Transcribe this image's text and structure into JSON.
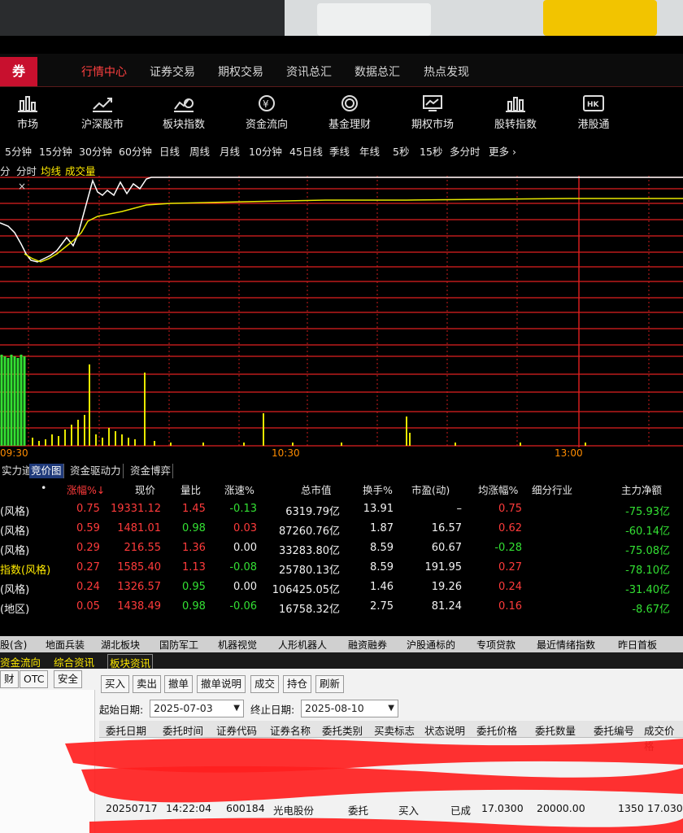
{
  "brand": "券",
  "menu": [
    "行情中心",
    "证券交易",
    "期权交易",
    "资讯总汇",
    "数据总汇",
    "热点发现"
  ],
  "icons": [
    {
      "label": "市场",
      "icon": "bar-chart-icon"
    },
    {
      "label": "沪深股市",
      "icon": "line-chart-icon"
    },
    {
      "label": "板块指数",
      "icon": "sector-chart-icon"
    },
    {
      "label": "资金流向",
      "icon": "fund-flow-icon"
    },
    {
      "label": "基金理财",
      "icon": "yen-coin-icon"
    },
    {
      "label": "期权市场",
      "icon": "monitor-icon"
    },
    {
      "label": "股转指数",
      "icon": "bar-index-icon"
    },
    {
      "label": "港股通",
      "icon": "hk-icon"
    }
  ],
  "periods": [
    "5分钟",
    "15分钟",
    "30分钟",
    "60分钟",
    "日线",
    "周线",
    "月线",
    "10分钟",
    "45日线",
    "季线",
    "年线",
    "5秒",
    "15秒",
    "多分时",
    "更多 ›"
  ],
  "subtabs": {
    "a": "分",
    "b": "分时",
    "c": "均线",
    "d": "成交量"
  },
  "close_mark": "×",
  "times": {
    "t1": "09:30",
    "t2": "10:30",
    "t3": "13:00"
  },
  "tabs": [
    "实力道",
    "竞价图",
    "资金驱动力",
    "资金博弈"
  ],
  "table": {
    "headers": {
      "dot": "•",
      "chg": "涨幅%↓",
      "price": "现价",
      "ratio": "量比",
      "speed": "涨速%",
      "cap": "总市值",
      "turn": "换手%",
      "pe": "市盈(动)",
      "avg": "均涨幅%",
      "ind": "细分行业",
      "net": "主力净额"
    },
    "rows": [
      {
        "name": "(风格)",
        "chg": "0.75",
        "price": "19331.12",
        "ratio": "1.45",
        "speed": "-0.13",
        "cap": "6319.79亿",
        "turn": "13.91",
        "pe": "–",
        "avg": "0.75",
        "net": "-75.93亿"
      },
      {
        "name": "(风格)",
        "chg": "0.59",
        "price": "1481.01",
        "ratio": "0.98",
        "speed": "0.03",
        "cap": "87260.76亿",
        "turn": "1.87",
        "pe": "16.57",
        "avg": "0.62",
        "net": "-60.14亿"
      },
      {
        "name": "(风格)",
        "chg": "0.29",
        "price": "216.55",
        "ratio": "1.36",
        "speed": "0.00",
        "cap": "33283.80亿",
        "turn": "8.59",
        "pe": "60.67",
        "avg": "-0.28",
        "net": "-75.08亿"
      },
      {
        "name": "指数(风格)",
        "chg": "0.27",
        "price": "1585.40",
        "ratio": "1.13",
        "speed": "-0.08",
        "cap": "25780.13亿",
        "turn": "8.59",
        "pe": "191.95",
        "avg": "0.27",
        "net": "-78.10亿"
      },
      {
        "name": "(风格)",
        "chg": "0.24",
        "price": "1326.57",
        "ratio": "0.95",
        "speed": "0.00",
        "cap": "106425.05亿",
        "turn": "1.46",
        "pe": "19.26",
        "avg": "0.24",
        "net": "-31.40亿"
      },
      {
        "name": "(地区)",
        "chg": "0.05",
        "price": "1438.49",
        "ratio": "0.98",
        "speed": "-0.06",
        "cap": "16758.32亿",
        "turn": "2.75",
        "pe": "81.24",
        "avg": "0.16",
        "net": "-8.67亿"
      }
    ]
  },
  "sectors": [
    "股(含)",
    "地面兵装",
    "湖北板块",
    "国防军工",
    "机器视觉",
    "人形机器人",
    "融资融券",
    "沪股通标的",
    "专项贷款",
    "最近情绪指数",
    "昨日首板"
  ],
  "news": [
    "资金流向",
    "综合资讯",
    "板块资讯"
  ],
  "side_tabs": [
    "财",
    "OTC",
    "安全"
  ],
  "trade": {
    "buttons": [
      "买入",
      "卖出",
      "撤单",
      "撤单说明",
      "成交",
      "持仓",
      "刷新"
    ],
    "start_label": "起始日期:",
    "start_date": "2025-07-03",
    "end_label": "终止日期:",
    "end_date": "2025-08-10",
    "columns": [
      "委托日期",
      "委托时间",
      "证券代码",
      "证券名称",
      "委托类别",
      "买卖标志",
      "状态说明",
      "委托价格",
      "委托数量",
      "委托编号",
      "成交价格"
    ],
    "row": {
      "date": "20250717",
      "time": "14:22:04",
      "code": "600184",
      "name": "光电股份",
      "type": "委托",
      "side": "买入",
      "status": "已成",
      "price": "17.0300",
      "qty": "20000.00",
      "no": "1350",
      "deal": "17.030"
    }
  },
  "colors": {
    "menu_active": "#ff4040",
    "grid": "#e02020",
    "price_line": "#ffffff",
    "avg_line": "#e8e800",
    "up": "#ff3b3b",
    "down": "#33e033",
    "redact": "#ff2020"
  }
}
